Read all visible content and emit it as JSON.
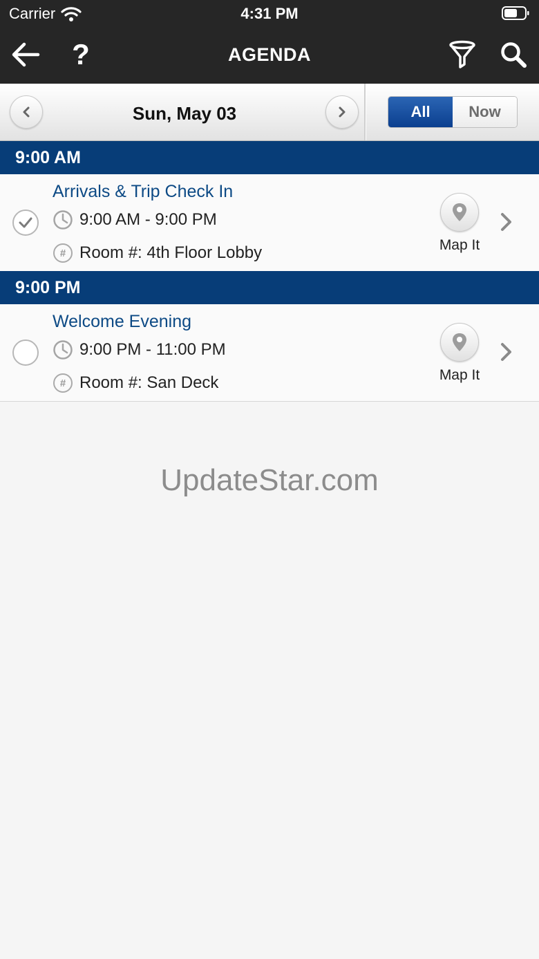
{
  "status_bar": {
    "carrier": "Carrier",
    "time": "4:31 PM"
  },
  "nav": {
    "title": "AGENDA",
    "help": "?"
  },
  "date_bar": {
    "date": "Sun, May 03",
    "filter_all": "All",
    "filter_now": "Now",
    "selected": "All"
  },
  "sections": [
    {
      "time": "9:00 AM",
      "items": [
        {
          "title": "Arrivals & Trip Check In",
          "time_range": "9:00 AM - 9:00 PM",
          "room": "Room #: 4th Floor Lobby",
          "checked": true,
          "map_label": "Map It"
        }
      ]
    },
    {
      "time": "9:00 PM",
      "items": [
        {
          "title": "Welcome Evening",
          "time_range": "9:00 PM - 11:00 PM",
          "room": "Room #: San Deck",
          "checked": false,
          "map_label": "Map It"
        }
      ]
    }
  ],
  "watermark": "UpdateStar.com",
  "colors": {
    "header": "#262626",
    "section": "#073d78",
    "title_text": "#0d4a85",
    "segment_active": "#0b3f8f"
  }
}
